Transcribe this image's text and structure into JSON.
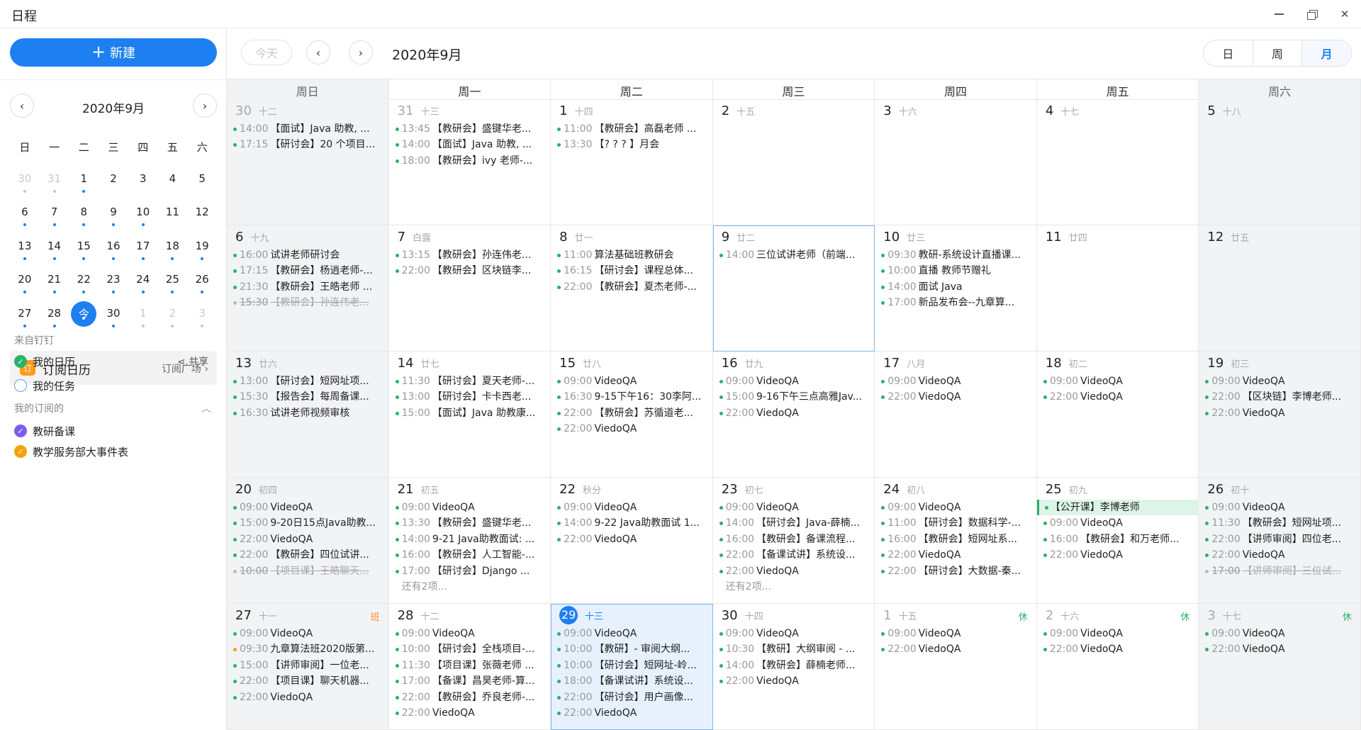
{
  "app": {
    "title": "日程"
  },
  "sidebar": {
    "new_button": "新建",
    "mini_calendar": {
      "title": "2020年9月",
      "weekdays": [
        "日",
        "一",
        "二",
        "三",
        "四",
        "五",
        "六"
      ],
      "days": [
        {
          "d": "30",
          "other": true,
          "dot": true
        },
        {
          "d": "31",
          "other": true,
          "dot": true
        },
        {
          "d": "1",
          "dot": true
        },
        {
          "d": "2"
        },
        {
          "d": "3"
        },
        {
          "d": "4"
        },
        {
          "d": "5"
        },
        {
          "d": "6",
          "dot": true
        },
        {
          "d": "7",
          "dot": true
        },
        {
          "d": "8",
          "dot": true
        },
        {
          "d": "9",
          "dot": true
        },
        {
          "d": "10",
          "dot": true
        },
        {
          "d": "11"
        },
        {
          "d": "12"
        },
        {
          "d": "13",
          "dot": true
        },
        {
          "d": "14",
          "dot": true
        },
        {
          "d": "15",
          "dot": true
        },
        {
          "d": "16",
          "dot": true
        },
        {
          "d": "17",
          "dot": true
        },
        {
          "d": "18",
          "dot": true
        },
        {
          "d": "19",
          "dot": true
        },
        {
          "d": "20",
          "dot": true
        },
        {
          "d": "21",
          "dot": true
        },
        {
          "d": "22",
          "dot": true
        },
        {
          "d": "23",
          "dot": true
        },
        {
          "d": "24",
          "dot": true
        },
        {
          "d": "25",
          "dot": true
        },
        {
          "d": "26",
          "dot": true
        },
        {
          "d": "27",
          "dot": true
        },
        {
          "d": "28",
          "dot": true
        },
        {
          "d": "今",
          "today": true,
          "dot": true
        },
        {
          "d": "30",
          "dot": true
        },
        {
          "d": "1",
          "other": true,
          "dot": true
        },
        {
          "d": "2",
          "other": true,
          "dot": true
        },
        {
          "d": "3",
          "other": true,
          "dot": true
        }
      ]
    },
    "subscribe": {
      "title": "订阅日历",
      "link": "订阅广场",
      "icon_text": "订"
    },
    "from_dingtalk": "来自钉钉",
    "my_calendar": "我的日历",
    "my_tasks": "我的任务",
    "share": "共享",
    "subscribed": "我的订阅的",
    "subscribed_items": [
      "教研备课",
      "教学服务部大事件表"
    ]
  },
  "toolbar": {
    "today": "今天",
    "title": "2020年9月",
    "views": [
      "日",
      "周",
      "月"
    ],
    "active_view": "月"
  },
  "month": {
    "weekday_headers": [
      "周日",
      "周一",
      "周二",
      "周三",
      "周四",
      "周五",
      "周六"
    ],
    "cells": [
      {
        "num": "30",
        "lunar": "十二",
        "other": true,
        "events": [
          {
            "t": "14:00",
            "x": "【面试】Java 助教, ..."
          },
          {
            "t": "17:15",
            "x": "【研讨会】20 个项目..."
          }
        ]
      },
      {
        "num": "31",
        "lunar": "十三",
        "other": true,
        "events": [
          {
            "t": "13:45",
            "x": "【教研会】盛键华老..."
          },
          {
            "t": "14:00",
            "x": "【面试】Java 助教, ..."
          },
          {
            "t": "18:00",
            "x": "【教研会】ivy 老师-..."
          }
        ]
      },
      {
        "num": "1",
        "lunar": "十四",
        "events": [
          {
            "t": "11:00",
            "x": "【教研会】高磊老师 ..."
          },
          {
            "t": "13:30",
            "x": "【? ? ? 】月会"
          }
        ]
      },
      {
        "num": "2",
        "lunar": "十五",
        "events": []
      },
      {
        "num": "3",
        "lunar": "十六",
        "events": []
      },
      {
        "num": "4",
        "lunar": "十七",
        "events": []
      },
      {
        "num": "5",
        "lunar": "十八",
        "events": []
      },
      {
        "num": "6",
        "lunar": "十九",
        "events": [
          {
            "t": "16:00",
            "x": "试讲老师研讨会"
          },
          {
            "t": "17:15",
            "x": "【教研会】杨逍老师-..."
          },
          {
            "t": "21:30",
            "x": "【教研会】王皓老师 ..."
          },
          {
            "t": "15:30",
            "x": "【教研会】孙连伟老...",
            "done": true
          }
        ]
      },
      {
        "num": "7",
        "lunar": "白露",
        "events": [
          {
            "t": "13:15",
            "x": "【教研会】孙连伟老..."
          },
          {
            "t": "22:00",
            "x": "【教研会】区块链李..."
          }
        ]
      },
      {
        "num": "8",
        "lunar": "廿一",
        "events": [
          {
            "t": "11:00",
            "x": "算法基础班教研会"
          },
          {
            "t": "16:15",
            "x": "【研讨会】课程总体..."
          },
          {
            "t": "22:00",
            "x": "【教研会】夏杰老师-..."
          }
        ]
      },
      {
        "num": "9",
        "lunar": "廿二",
        "selected": true,
        "events": [
          {
            "t": "14:00",
            "x": "三位试讲老师（前端..."
          }
        ]
      },
      {
        "num": "10",
        "lunar": "廿三",
        "events": [
          {
            "t": "09:30",
            "x": "教研-系统设计直播课..."
          },
          {
            "t": "10:00",
            "x": "直播 教师节赠礼"
          },
          {
            "t": "14:00",
            "x": "面试 Java"
          },
          {
            "t": "17:00",
            "x": "新品发布会--九章算..."
          }
        ]
      },
      {
        "num": "11",
        "lunar": "廿四",
        "events": []
      },
      {
        "num": "12",
        "lunar": "廿五",
        "events": []
      },
      {
        "num": "13",
        "lunar": "廿六",
        "events": [
          {
            "t": "13:00",
            "x": "【研讨会】短网址项..."
          },
          {
            "t": "15:30",
            "x": "【报告会】每周备课..."
          },
          {
            "t": "16:30",
            "x": "试讲老师视频审核"
          }
        ]
      },
      {
        "num": "14",
        "lunar": "廿七",
        "events": [
          {
            "t": "11:30",
            "x": "【研讨会】夏天老师-..."
          },
          {
            "t": "13:00",
            "x": "【研讨会】卡卡西老..."
          },
          {
            "t": "15:00",
            "x": "【面试】Java 助教康..."
          }
        ]
      },
      {
        "num": "15",
        "lunar": "廿八",
        "events": [
          {
            "t": "09:00",
            "x": "VideoQA"
          },
          {
            "t": "16:30",
            "x": "9-15下午16：30李阿..."
          },
          {
            "t": "22:00",
            "x": "【教研会】苏循道老..."
          },
          {
            "t": "22:00",
            "x": "ViedoQA"
          }
        ]
      },
      {
        "num": "16",
        "lunar": "廿九",
        "events": [
          {
            "t": "09:00",
            "x": "VideoQA"
          },
          {
            "t": "15:00",
            "x": "9-16下午三点高雅Jav..."
          },
          {
            "t": "22:00",
            "x": "ViedoQA"
          }
        ]
      },
      {
        "num": "17",
        "lunar": "八月",
        "events": [
          {
            "t": "09:00",
            "x": "VideoQA"
          },
          {
            "t": "22:00",
            "x": "ViedoQA"
          }
        ]
      },
      {
        "num": "18",
        "lunar": "初二",
        "events": [
          {
            "t": "09:00",
            "x": "VideoQA"
          },
          {
            "t": "22:00",
            "x": "ViedoQA"
          }
        ]
      },
      {
        "num": "19",
        "lunar": "初三",
        "events": [
          {
            "t": "09:00",
            "x": "VideoQA"
          },
          {
            "t": "22:00",
            "x": "【区块链】李博老师..."
          },
          {
            "t": "22:00",
            "x": "ViedoQA"
          }
        ]
      },
      {
        "num": "20",
        "lunar": "初四",
        "events": [
          {
            "t": "09:00",
            "x": "VideoQA"
          },
          {
            "t": "15:00",
            "x": "9-20日15点Java助教..."
          },
          {
            "t": "22:00",
            "x": "ViedoQA"
          },
          {
            "t": "22:00",
            "x": "【教研会】四位试讲..."
          },
          {
            "t": "10:00",
            "x": "【项目课】王皓聊天...",
            "done": true
          }
        ]
      },
      {
        "num": "21",
        "lunar": "初五",
        "more": "还有2项...",
        "events": [
          {
            "t": "09:00",
            "x": "VideoQA"
          },
          {
            "t": "13:30",
            "x": "【教研会】盛键华老..."
          },
          {
            "t": "14:00",
            "x": "9-21 Java助教面试: ..."
          },
          {
            "t": "16:00",
            "x": "【教研会】人工智能-..."
          },
          {
            "t": "17:00",
            "x": "【研讨会】Django ..."
          }
        ]
      },
      {
        "num": "22",
        "lunar": "秋分",
        "events": [
          {
            "t": "09:00",
            "x": "VideoQA"
          },
          {
            "t": "14:00",
            "x": "9-22 Java助教面试 1..."
          },
          {
            "t": "22:00",
            "x": "ViedoQA"
          }
        ]
      },
      {
        "num": "23",
        "lunar": "初七",
        "more": "还有2项...",
        "events": [
          {
            "t": "09:00",
            "x": "VideoQA"
          },
          {
            "t": "14:00",
            "x": "【研讨会】Java-薛楠..."
          },
          {
            "t": "16:00",
            "x": "【教研会】备课流程..."
          },
          {
            "t": "22:00",
            "x": "【备课试讲】系统设..."
          },
          {
            "t": "22:00",
            "x": "ViedoQA"
          }
        ]
      },
      {
        "num": "24",
        "lunar": "初八",
        "events": [
          {
            "t": "09:00",
            "x": "VideoQA"
          },
          {
            "t": "11:00",
            "x": "【研讨会】数据科学-..."
          },
          {
            "t": "16:00",
            "x": "【教研会】短网址系..."
          },
          {
            "t": "22:00",
            "x": "ViedoQA"
          },
          {
            "t": "22:00",
            "x": "【研讨会】大数据-秦..."
          }
        ]
      },
      {
        "num": "25",
        "lunar": "初九",
        "events": [
          {
            "t": "",
            "x": "【公开课】李博老师",
            "hl": true
          },
          {
            "t": "09:00",
            "x": "VideoQA"
          },
          {
            "t": "16:00",
            "x": "【教研会】和万老师..."
          },
          {
            "t": "22:00",
            "x": "ViedoQA"
          }
        ]
      },
      {
        "num": "26",
        "lunar": "初十",
        "events": [
          {
            "t": "09:00",
            "x": "VideoQA"
          },
          {
            "t": "11:30",
            "x": "【教研会】短网址项..."
          },
          {
            "t": "22:00",
            "x": "【讲师审阅】四位老..."
          },
          {
            "t": "22:00",
            "x": "ViedoQA"
          },
          {
            "t": "17:00",
            "x": "【讲师审阅】三位试...",
            "done": true
          }
        ]
      },
      {
        "num": "27",
        "lunar": "十一",
        "tag": "班",
        "events": [
          {
            "t": "09:00",
            "x": "VideoQA"
          },
          {
            "t": "09:30",
            "x": "九章算法班2020版第...",
            "orange": true
          },
          {
            "t": "15:00",
            "x": "【讲师审阅】一位老..."
          },
          {
            "t": "22:00",
            "x": "【项目课】聊天机器..."
          },
          {
            "t": "22:00",
            "x": "ViedoQA"
          }
        ]
      },
      {
        "num": "28",
        "lunar": "十二",
        "events": [
          {
            "t": "09:00",
            "x": "VideoQA"
          },
          {
            "t": "10:00",
            "x": "【研讨会】全栈项目-..."
          },
          {
            "t": "11:30",
            "x": "【项目课】张薇老师 ..."
          },
          {
            "t": "17:00",
            "x": "【备课】昌昊老师-算..."
          },
          {
            "t": "22:00",
            "x": "【教研会】乔良老师-..."
          },
          {
            "t": "22:00",
            "x": "ViedoQA"
          }
        ]
      },
      {
        "num": "29",
        "lunar": "十三",
        "today": true,
        "events": [
          {
            "t": "09:00",
            "x": "VideoQA"
          },
          {
            "t": "10:00",
            "x": "【教研】- 审阅大纲..."
          },
          {
            "t": "10:00",
            "x": "【研讨会】短网址-岭..."
          },
          {
            "t": "18:00",
            "x": "【备课试讲】系统设..."
          },
          {
            "t": "22:00",
            "x": "【研讨会】用户画像..."
          },
          {
            "t": "22:00",
            "x": "ViedoQA"
          }
        ]
      },
      {
        "num": "30",
        "lunar": "十四",
        "events": [
          {
            "t": "09:00",
            "x": "VideoQA"
          },
          {
            "t": "10:30",
            "x": "【教研】大纲审阅 - ..."
          },
          {
            "t": "14:00",
            "x": "【教研会】薛楠老师..."
          },
          {
            "t": "22:00",
            "x": "ViedoQA"
          }
        ]
      },
      {
        "num": "1",
        "lunar": "十五",
        "other": true,
        "tag": "休",
        "events": [
          {
            "t": "09:00",
            "x": "VideoQA"
          },
          {
            "t": "22:00",
            "x": "ViedoQA"
          }
        ]
      },
      {
        "num": "2",
        "lunar": "十六",
        "other": true,
        "tag": "休",
        "events": [
          {
            "t": "09:00",
            "x": "VideoQA"
          },
          {
            "t": "22:00",
            "x": "ViedoQA"
          }
        ]
      },
      {
        "num": "3",
        "lunar": "十七",
        "other": true,
        "tag": "休",
        "events": [
          {
            "t": "09:00",
            "x": "VideoQA"
          },
          {
            "t": "22:00",
            "x": "ViedoQA"
          }
        ]
      }
    ]
  },
  "colors": {
    "accent": "#1e7ff0",
    "event_dot": "#25b36a",
    "weekend_bg": "#f1f3f5"
  }
}
